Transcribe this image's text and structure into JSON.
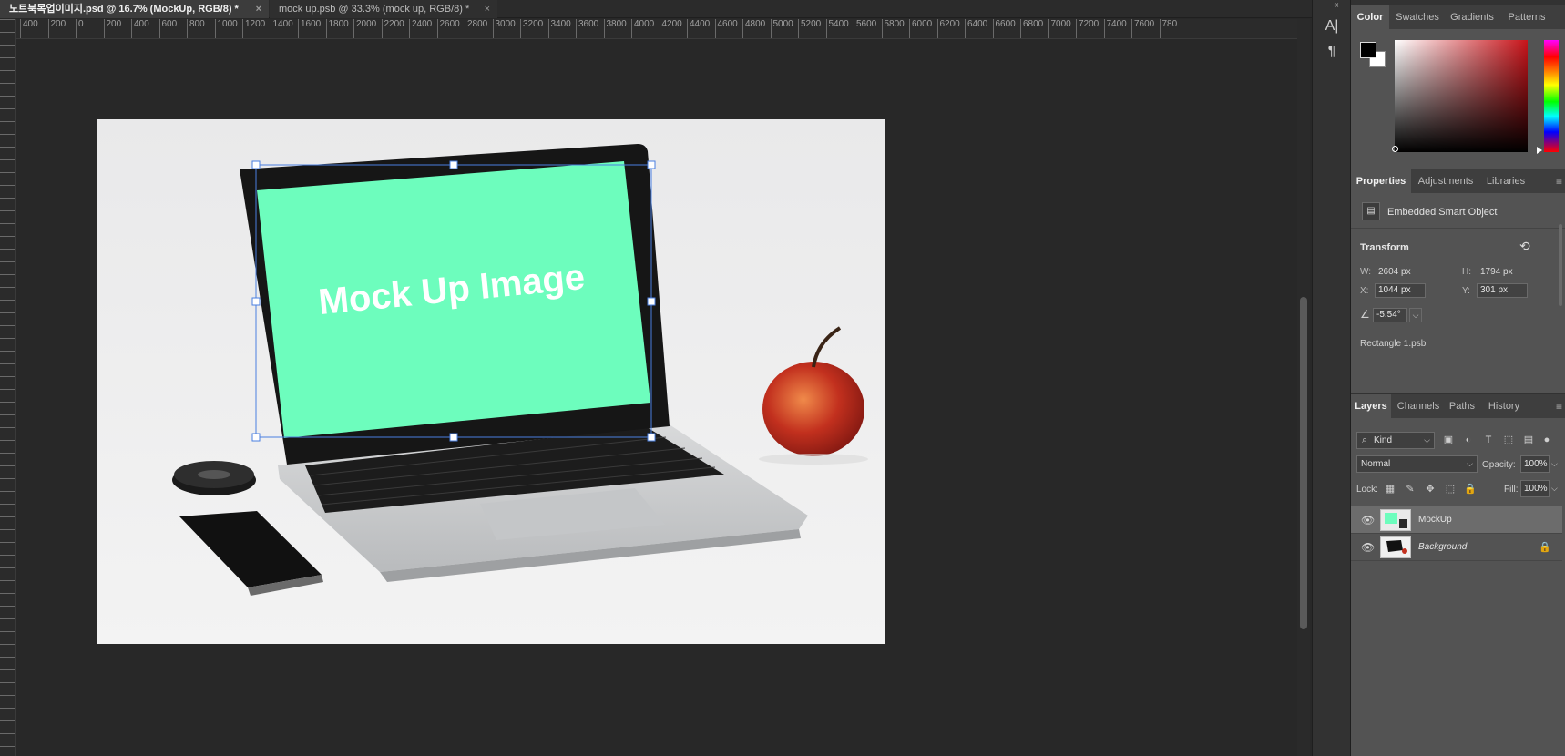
{
  "tabs": [
    {
      "label": "노트북목업이미지.psd @ 16.7% (MockUp, RGB/8) *",
      "close": "×"
    },
    {
      "label": "mock up.psb @ 33.3% (mock up, RGB/8) *",
      "close": "×"
    }
  ],
  "ruler": {
    "h_ticks": [
      "400",
      "200",
      "0",
      "200",
      "400",
      "600",
      "800",
      "1000",
      "1200",
      "1400",
      "1600",
      "1800",
      "2000",
      "2200",
      "2400",
      "2600",
      "2800",
      "3000",
      "3200",
      "3400",
      "3600",
      "3800",
      "4000",
      "4200",
      "4400",
      "4600",
      "4800",
      "5000",
      "5200",
      "5400",
      "5600",
      "5800",
      "6000",
      "6200",
      "6400",
      "6600",
      "6800",
      "7000",
      "7200",
      "7400",
      "7600",
      "780"
    ]
  },
  "document": {
    "screen_text": "Mock Up Image",
    "screen_color": "#6dfdbd"
  },
  "tool_strip": {
    "icons": [
      "character-icon",
      "paragraph-icon"
    ],
    "glyphs": [
      "A|",
      "¶"
    ],
    "collapse": "«"
  },
  "color_panel": {
    "tabs": [
      "Color",
      "Swatches",
      "Gradients",
      "Patterns"
    ],
    "active_tab": "Color",
    "foreground": "#000000",
    "background": "#ffffff",
    "hue_color": "#c8141a"
  },
  "properties_panel": {
    "tabs": [
      "Properties",
      "Adjustments",
      "Libraries"
    ],
    "active_tab": "Properties",
    "object_type": "Embedded Smart Object",
    "transform_label": "Transform",
    "w_label": "W:",
    "w_value": "2604 px",
    "h_label": "H:",
    "h_value": "1794 px",
    "x_label": "X:",
    "x_value": "1044 px",
    "y_label": "Y:",
    "y_value": "301 px",
    "angle_value": "-5.54°",
    "linked_file": "Rectangle 1.psb"
  },
  "layers_panel": {
    "tabs": [
      "Layers",
      "Channels",
      "Paths",
      "History"
    ],
    "active_tab": "Layers",
    "kind_label": "Kind",
    "blend_mode": "Normal",
    "opacity_label": "Opacity:",
    "opacity_value": "100%",
    "lock_label": "Lock:",
    "fill_label": "Fill:",
    "fill_value": "100%",
    "layers": [
      {
        "name": "MockUp",
        "visible": true,
        "selected": true
      },
      {
        "name": "Background",
        "visible": true,
        "selected": false,
        "locked": true
      }
    ]
  },
  "panel_menu_glyph": "≡"
}
